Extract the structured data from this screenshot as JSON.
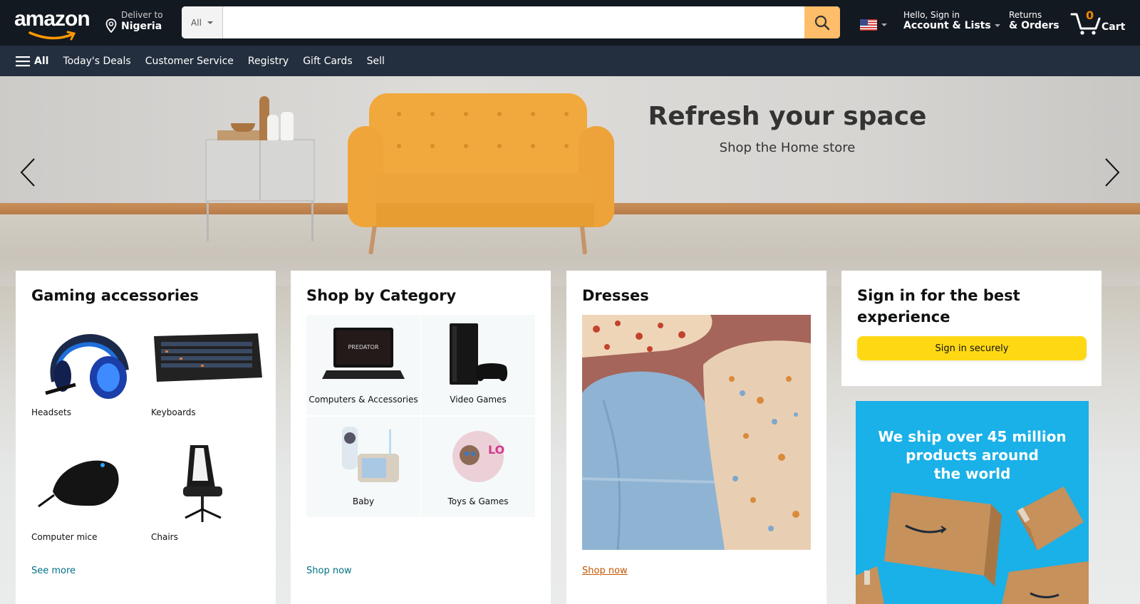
{
  "header": {
    "logo_text": "amazon",
    "deliver_label": "Deliver to",
    "deliver_location": "Nigeria",
    "search": {
      "category": "All",
      "placeholder": "",
      "value": ""
    },
    "language_flag": "us-flag-icon",
    "account_greeting": "Hello, Sign in",
    "account_label": "Account & Lists",
    "returns_label": "Returns",
    "orders_label": "& Orders",
    "cart_count": "0",
    "cart_label": "Cart"
  },
  "subnav": {
    "all_label": "All",
    "items": [
      "Today's Deals",
      "Customer Service",
      "Registry",
      "Gift Cards",
      "Sell"
    ]
  },
  "hero": {
    "title": "Refresh your space",
    "subtitle": "Shop the Home store"
  },
  "cards": {
    "gaming": {
      "title": "Gaming accessories",
      "items": [
        "Headsets",
        "Keyboards",
        "Computer mice",
        "Chairs"
      ],
      "link": "See more"
    },
    "category": {
      "title": "Shop by Category",
      "items": [
        "Computers & Accessories",
        "Video Games",
        "Baby",
        "Toys & Games"
      ],
      "link": "Shop now"
    },
    "dresses": {
      "title": "Dresses",
      "link": "Shop now"
    },
    "signin": {
      "title": "Sign in for the best experience",
      "button": "Sign in securely"
    },
    "shipping_ad": {
      "text_line1": "We ship over 45 million",
      "text_line2": "products around",
      "text_line3": "the world"
    }
  },
  "colors": {
    "header_bg": "#131921",
    "subnav_bg": "#232f3e",
    "search_button": "#febd69",
    "cart_count": "#f08804",
    "signin_button": "#ffd814",
    "link": "#007185",
    "dresses_link": "#c45500",
    "ship_ad_bg": "#1ab0e8"
  }
}
